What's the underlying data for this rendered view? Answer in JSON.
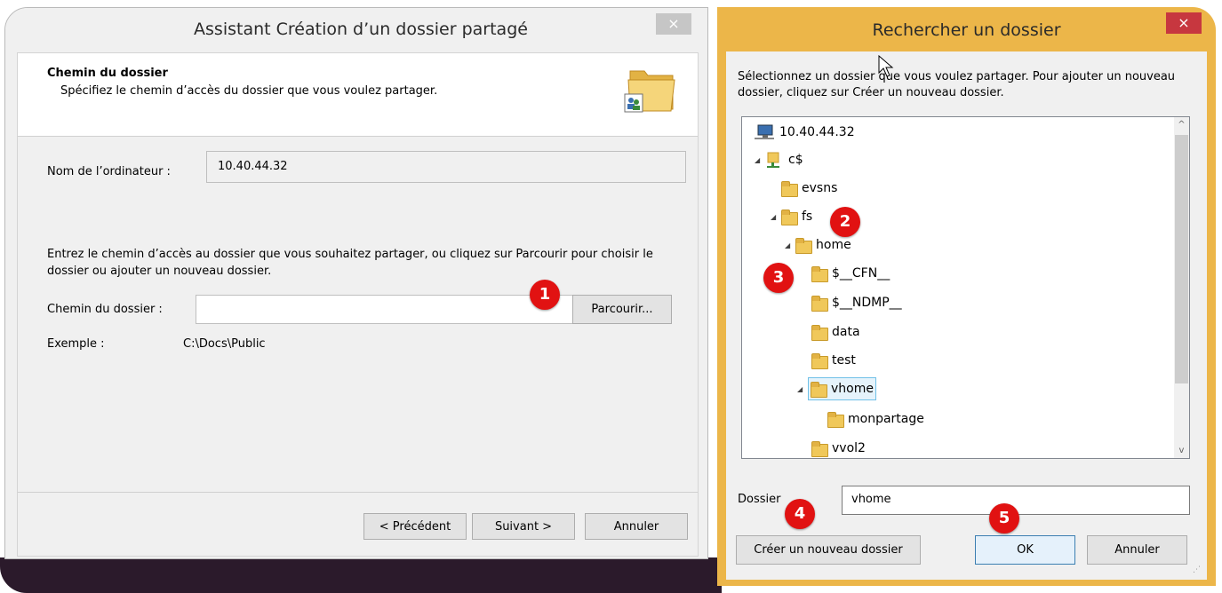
{
  "wizard": {
    "title": "Assistant Création d’un dossier partagé",
    "close_glyph": "×",
    "header_title": "Chemin du dossier",
    "header_subtitle": "Spécifiez le chemin d’accès du dossier que vous voulez partager.",
    "computer_label": "Nom de l’ordinateur :",
    "computer_value": "10.40.44.32",
    "instructions": "Entrez le chemin d’accès au dossier que vous souhaitez partager, ou cliquez sur Parcourir pour choisir le dossier ou ajouter un nouveau dossier.",
    "path_label": "Chemin du dossier :",
    "path_value": "",
    "browse_button": "Parcourir...",
    "example_label": "Exemple :",
    "example_value": "C:\\Docs\\Public",
    "prev_button": "< Précédent",
    "next_button": "Suivant >",
    "cancel_button": "Annuler"
  },
  "browse_dialog": {
    "title": "Rechercher un dossier",
    "close_glyph": "×",
    "description": "Sélectionnez un dossier que vous voulez partager. Pour ajouter un nouveau dossier, cliquez sur Créer un nouveau dossier.",
    "tree": {
      "root": "10.40.44.32",
      "share": "c$",
      "evsns": "evsns",
      "fs": "fs",
      "home": "home",
      "cfn": "$__CFN__",
      "ndmp": "$__NDMP__",
      "data": "data",
      "test": "test",
      "vhome": "vhome",
      "monpartage": "monpartage",
      "vvol2": "vvol2"
    },
    "folder_label": "Dossier",
    "folder_value": "vhome",
    "new_folder_button": "Créer un nouveau dossier",
    "ok_button": "OK",
    "cancel_button": "Annuler"
  },
  "badges": [
    "1",
    "2",
    "3",
    "4",
    "5"
  ],
  "colors": {
    "badge": "#e11212",
    "browse_frame": "#ecb649",
    "close_active": "#c7373f",
    "selection": "#e5f3fb"
  }
}
